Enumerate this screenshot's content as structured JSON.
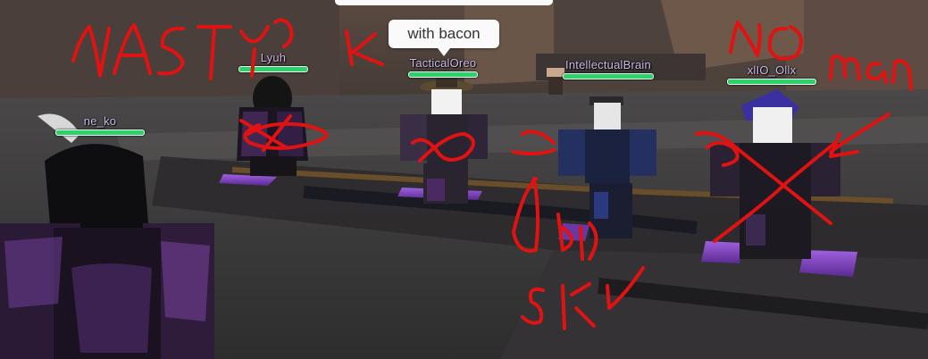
{
  "chat": {
    "bubble_text": "with bacon"
  },
  "players": [
    {
      "name": "ne_ko",
      "health": 1.0
    },
    {
      "name": "Lyuh",
      "health": 1.0
    },
    {
      "name": "TacticalOreo",
      "health": 1.0
    },
    {
      "name": "IntellectualBrain",
      "health": 1.0
    },
    {
      "name": "xlIO_Ollx",
      "health": 1.0
    }
  ],
  "colors": {
    "nametag": "#cbb8e6",
    "health": "#2dd06a",
    "scribble": "#e11212"
  }
}
